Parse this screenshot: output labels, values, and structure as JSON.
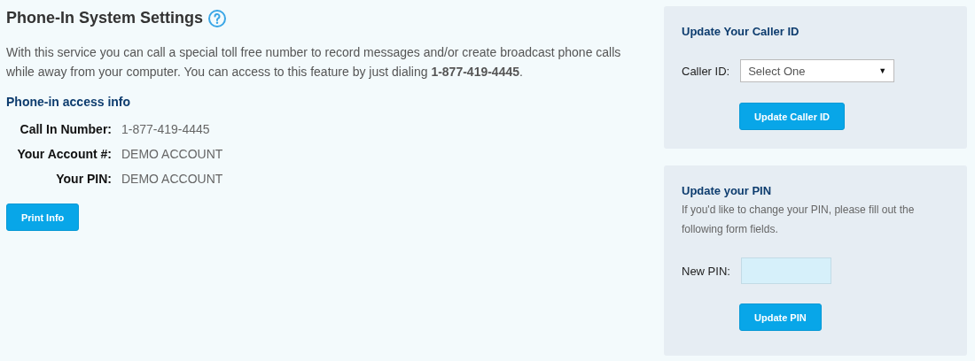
{
  "title": "Phone-In System Settings",
  "description": "With this service you can call a special toll free number to record messages and/or create broadcast phone calls while away from your computer. You can access to this feature by just dialing **1-877-419-4445**.",
  "access_info": {
    "heading": "Phone-in access info",
    "rows": [
      {
        "label": "Call In Number:",
        "value": "1-877-419-4445"
      },
      {
        "label": "Your Account #:",
        "value": "DEMO ACCOUNT"
      },
      {
        "label": "Your PIN:",
        "value": "DEMO ACCOUNT"
      }
    ]
  },
  "print_button": "Print Info",
  "caller_id_panel": {
    "heading": "Update Your Caller ID",
    "label": "Caller ID:",
    "select_value": "Select One",
    "arrow": "▼",
    "button": "Update Caller ID"
  },
  "pin_panel": {
    "heading": "Update your PIN",
    "text": "If you'd like to change your PIN, please fill out the following form fields.",
    "label": "New PIN:",
    "button": "Update PIN"
  }
}
